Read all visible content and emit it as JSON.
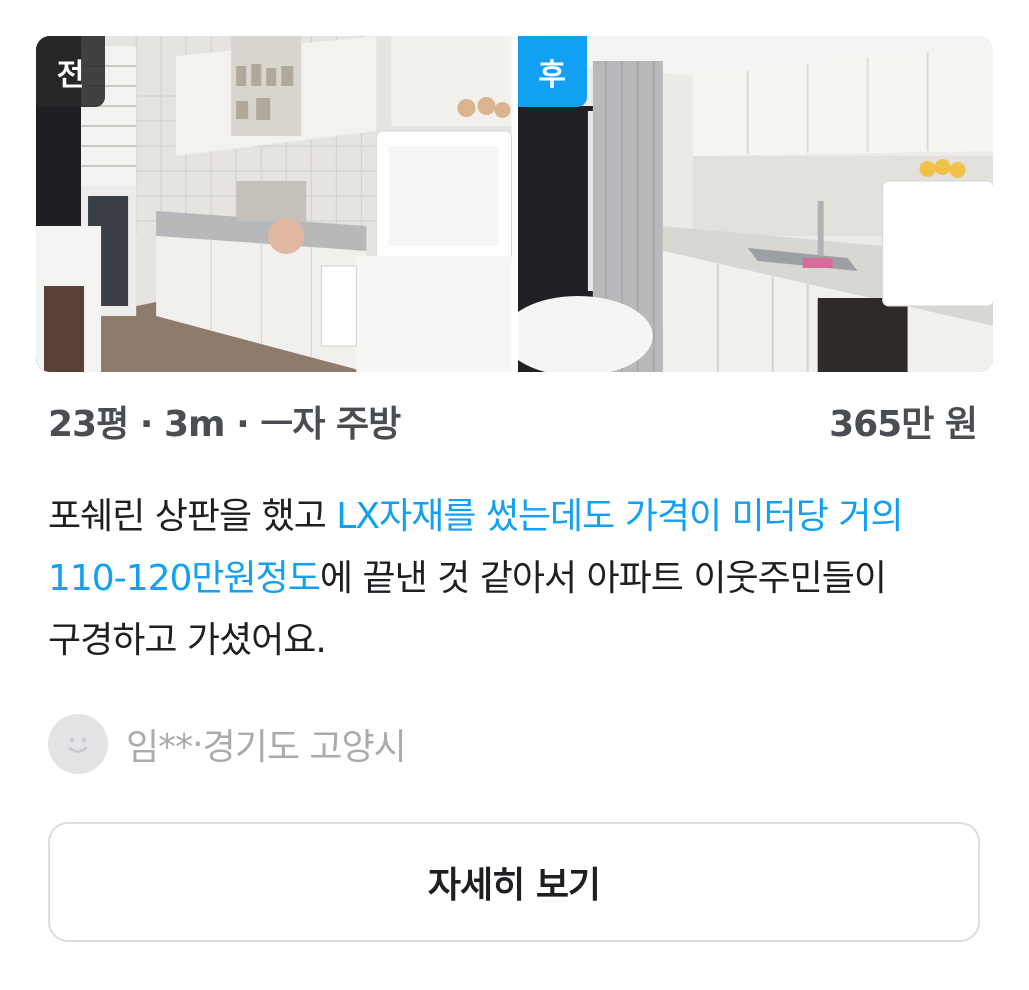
{
  "photos": {
    "before": {
      "tag": "전",
      "alt": "kitchen-before"
    },
    "after": {
      "tag": "후",
      "alt": "kitchen-after"
    }
  },
  "listing": {
    "area": "23평",
    "sep1": " · ",
    "length": "3m",
    "sep2": " · ",
    "type": "ㅡ자 주방",
    "price": "365만 원"
  },
  "description": {
    "line1_plain": "포쉐린 상판을 했고 ",
    "line1_highlight": "LX자재를 썼는데도 가격이 미터당 거의",
    "line2_highlight": "110-120만원정도",
    "line2_plain": "에 끝낸 것 같아서 아파트 이웃주민들이",
    "line3_plain": "구경하고 가셨어요."
  },
  "author": {
    "name": "임**",
    "sep": " · ",
    "location": "경기도 고양시"
  },
  "button": {
    "label": "자세히 보기"
  },
  "colors": {
    "accent": "#12a0f2",
    "text_primary": "#1e1f22",
    "text_secondary": "#4a4d52",
    "text_muted": "#a9abaf",
    "border": "#dadcdf"
  }
}
